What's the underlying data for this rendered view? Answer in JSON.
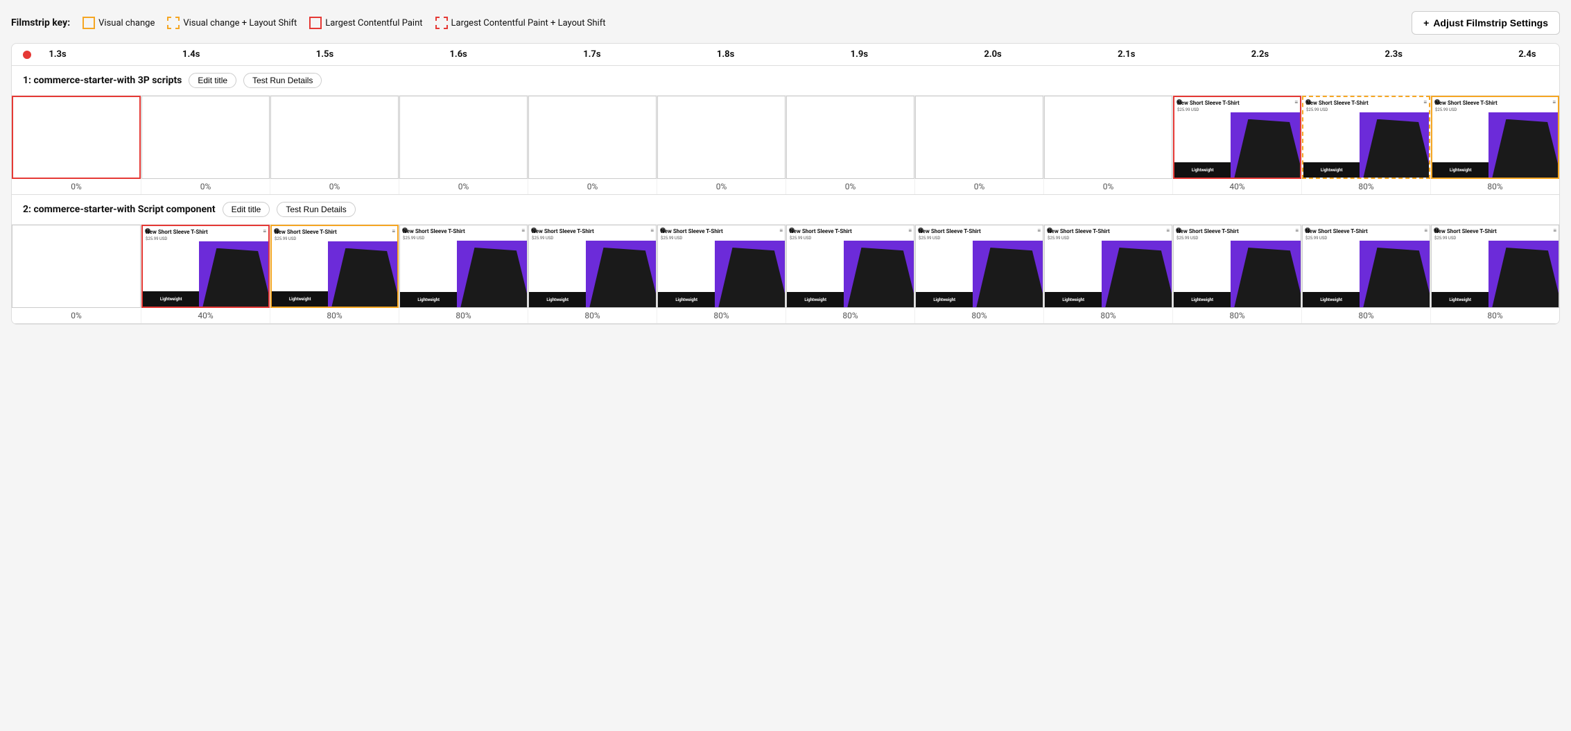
{
  "filmstrip_key": {
    "label": "Filmstrip key:",
    "items": [
      {
        "id": "visual-change",
        "label": "Visual change",
        "type": "solid-orange"
      },
      {
        "id": "visual-change-layout",
        "label": "Visual change + Layout Shift",
        "type": "dashed-orange"
      },
      {
        "id": "lcp",
        "label": "Largest Contentful Paint",
        "type": "solid-red"
      },
      {
        "id": "lcp-layout",
        "label": "Largest Contentful Paint + Layout Shift",
        "type": "dashed-red"
      }
    ]
  },
  "adjust_btn": {
    "label": "Adjust Filmstrip Settings",
    "icon": "+"
  },
  "timeline": {
    "timestamps": [
      "1.3s",
      "1.4s",
      "1.5s",
      "1.6s",
      "1.7s",
      "1.8s",
      "1.9s",
      "2.0s",
      "2.1s",
      "2.2s",
      "2.3s",
      "2.4s"
    ]
  },
  "runs": [
    {
      "id": "run1",
      "number": "1",
      "title": "commerce-starter-with 3P scripts",
      "edit_title_label": "Edit title",
      "test_run_label": "Test Run Details",
      "frames": [
        {
          "border": "red",
          "has_content": false,
          "pct": "0%"
        },
        {
          "border": "none",
          "has_content": false,
          "pct": "0%"
        },
        {
          "border": "none",
          "has_content": false,
          "pct": "0%"
        },
        {
          "border": "none",
          "has_content": false,
          "pct": "0%"
        },
        {
          "border": "none",
          "has_content": false,
          "pct": "0%"
        },
        {
          "border": "none",
          "has_content": false,
          "pct": "0%"
        },
        {
          "border": "none",
          "has_content": false,
          "pct": "0%"
        },
        {
          "border": "none",
          "has_content": false,
          "pct": "0%"
        },
        {
          "border": "none",
          "has_content": false,
          "pct": "0%"
        },
        {
          "border": "red",
          "has_content": true,
          "pct": "40%"
        },
        {
          "border": "orange-dashed",
          "has_content": true,
          "pct": "80%"
        },
        {
          "border": "orange",
          "has_content": true,
          "pct": "80%"
        }
      ]
    },
    {
      "id": "run2",
      "number": "2",
      "title": "commerce-starter-with Script component",
      "edit_title_label": "Edit title",
      "test_run_label": "Test Run Details",
      "frames": [
        {
          "border": "none",
          "has_content": false,
          "pct": "0%"
        },
        {
          "border": "red",
          "has_content": true,
          "pct": "40%"
        },
        {
          "border": "orange",
          "has_content": true,
          "pct": "80%"
        },
        {
          "border": "none",
          "has_content": true,
          "pct": "80%"
        },
        {
          "border": "none",
          "has_content": true,
          "pct": "80%"
        },
        {
          "border": "none",
          "has_content": true,
          "pct": "80%"
        },
        {
          "border": "none",
          "has_content": true,
          "pct": "80%"
        },
        {
          "border": "none",
          "has_content": true,
          "pct": "80%"
        },
        {
          "border": "none",
          "has_content": true,
          "pct": "80%"
        },
        {
          "border": "none",
          "has_content": true,
          "pct": "80%"
        },
        {
          "border": "none",
          "has_content": true,
          "pct": "80%"
        },
        {
          "border": "none",
          "has_content": true,
          "pct": "80%"
        }
      ]
    }
  ],
  "product": {
    "title": "New Short Sleeve T-Shirt",
    "price": "$25.99 USD",
    "tag": "Lightweight"
  }
}
